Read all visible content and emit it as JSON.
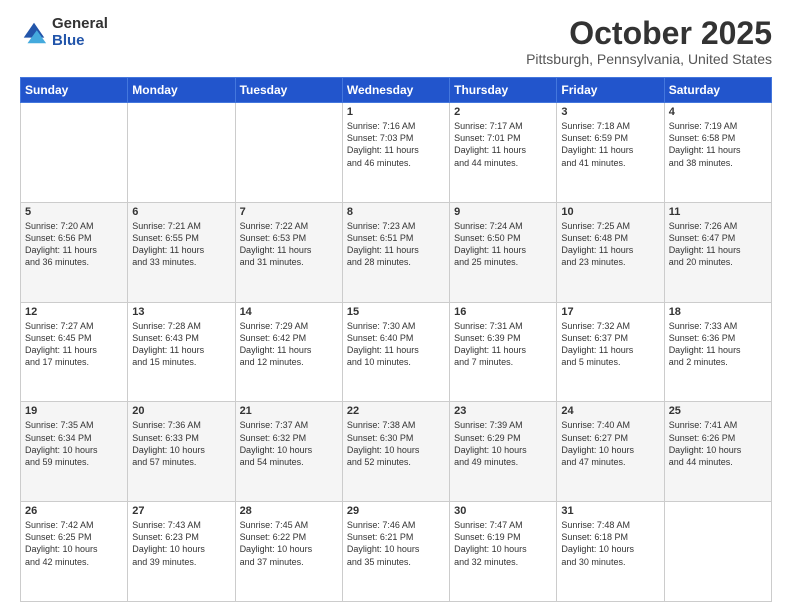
{
  "header": {
    "logo_general": "General",
    "logo_blue": "Blue",
    "month_title": "October 2025",
    "subtitle": "Pittsburgh, Pennsylvania, United States"
  },
  "days_of_week": [
    "Sunday",
    "Monday",
    "Tuesday",
    "Wednesday",
    "Thursday",
    "Friday",
    "Saturday"
  ],
  "weeks": [
    [
      {
        "day": "",
        "content": ""
      },
      {
        "day": "",
        "content": ""
      },
      {
        "day": "",
        "content": ""
      },
      {
        "day": "1",
        "content": "Sunrise: 7:16 AM\nSunset: 7:03 PM\nDaylight: 11 hours\nand 46 minutes."
      },
      {
        "day": "2",
        "content": "Sunrise: 7:17 AM\nSunset: 7:01 PM\nDaylight: 11 hours\nand 44 minutes."
      },
      {
        "day": "3",
        "content": "Sunrise: 7:18 AM\nSunset: 6:59 PM\nDaylight: 11 hours\nand 41 minutes."
      },
      {
        "day": "4",
        "content": "Sunrise: 7:19 AM\nSunset: 6:58 PM\nDaylight: 11 hours\nand 38 minutes."
      }
    ],
    [
      {
        "day": "5",
        "content": "Sunrise: 7:20 AM\nSunset: 6:56 PM\nDaylight: 11 hours\nand 36 minutes."
      },
      {
        "day": "6",
        "content": "Sunrise: 7:21 AM\nSunset: 6:55 PM\nDaylight: 11 hours\nand 33 minutes."
      },
      {
        "day": "7",
        "content": "Sunrise: 7:22 AM\nSunset: 6:53 PM\nDaylight: 11 hours\nand 31 minutes."
      },
      {
        "day": "8",
        "content": "Sunrise: 7:23 AM\nSunset: 6:51 PM\nDaylight: 11 hours\nand 28 minutes."
      },
      {
        "day": "9",
        "content": "Sunrise: 7:24 AM\nSunset: 6:50 PM\nDaylight: 11 hours\nand 25 minutes."
      },
      {
        "day": "10",
        "content": "Sunrise: 7:25 AM\nSunset: 6:48 PM\nDaylight: 11 hours\nand 23 minutes."
      },
      {
        "day": "11",
        "content": "Sunrise: 7:26 AM\nSunset: 6:47 PM\nDaylight: 11 hours\nand 20 minutes."
      }
    ],
    [
      {
        "day": "12",
        "content": "Sunrise: 7:27 AM\nSunset: 6:45 PM\nDaylight: 11 hours\nand 17 minutes."
      },
      {
        "day": "13",
        "content": "Sunrise: 7:28 AM\nSunset: 6:43 PM\nDaylight: 11 hours\nand 15 minutes."
      },
      {
        "day": "14",
        "content": "Sunrise: 7:29 AM\nSunset: 6:42 PM\nDaylight: 11 hours\nand 12 minutes."
      },
      {
        "day": "15",
        "content": "Sunrise: 7:30 AM\nSunset: 6:40 PM\nDaylight: 11 hours\nand 10 minutes."
      },
      {
        "day": "16",
        "content": "Sunrise: 7:31 AM\nSunset: 6:39 PM\nDaylight: 11 hours\nand 7 minutes."
      },
      {
        "day": "17",
        "content": "Sunrise: 7:32 AM\nSunset: 6:37 PM\nDaylight: 11 hours\nand 5 minutes."
      },
      {
        "day": "18",
        "content": "Sunrise: 7:33 AM\nSunset: 6:36 PM\nDaylight: 11 hours\nand 2 minutes."
      }
    ],
    [
      {
        "day": "19",
        "content": "Sunrise: 7:35 AM\nSunset: 6:34 PM\nDaylight: 10 hours\nand 59 minutes."
      },
      {
        "day": "20",
        "content": "Sunrise: 7:36 AM\nSunset: 6:33 PM\nDaylight: 10 hours\nand 57 minutes."
      },
      {
        "day": "21",
        "content": "Sunrise: 7:37 AM\nSunset: 6:32 PM\nDaylight: 10 hours\nand 54 minutes."
      },
      {
        "day": "22",
        "content": "Sunrise: 7:38 AM\nSunset: 6:30 PM\nDaylight: 10 hours\nand 52 minutes."
      },
      {
        "day": "23",
        "content": "Sunrise: 7:39 AM\nSunset: 6:29 PM\nDaylight: 10 hours\nand 49 minutes."
      },
      {
        "day": "24",
        "content": "Sunrise: 7:40 AM\nSunset: 6:27 PM\nDaylight: 10 hours\nand 47 minutes."
      },
      {
        "day": "25",
        "content": "Sunrise: 7:41 AM\nSunset: 6:26 PM\nDaylight: 10 hours\nand 44 minutes."
      }
    ],
    [
      {
        "day": "26",
        "content": "Sunrise: 7:42 AM\nSunset: 6:25 PM\nDaylight: 10 hours\nand 42 minutes."
      },
      {
        "day": "27",
        "content": "Sunrise: 7:43 AM\nSunset: 6:23 PM\nDaylight: 10 hours\nand 39 minutes."
      },
      {
        "day": "28",
        "content": "Sunrise: 7:45 AM\nSunset: 6:22 PM\nDaylight: 10 hours\nand 37 minutes."
      },
      {
        "day": "29",
        "content": "Sunrise: 7:46 AM\nSunset: 6:21 PM\nDaylight: 10 hours\nand 35 minutes."
      },
      {
        "day": "30",
        "content": "Sunrise: 7:47 AM\nSunset: 6:19 PM\nDaylight: 10 hours\nand 32 minutes."
      },
      {
        "day": "31",
        "content": "Sunrise: 7:48 AM\nSunset: 6:18 PM\nDaylight: 10 hours\nand 30 minutes."
      },
      {
        "day": "",
        "content": ""
      }
    ]
  ]
}
